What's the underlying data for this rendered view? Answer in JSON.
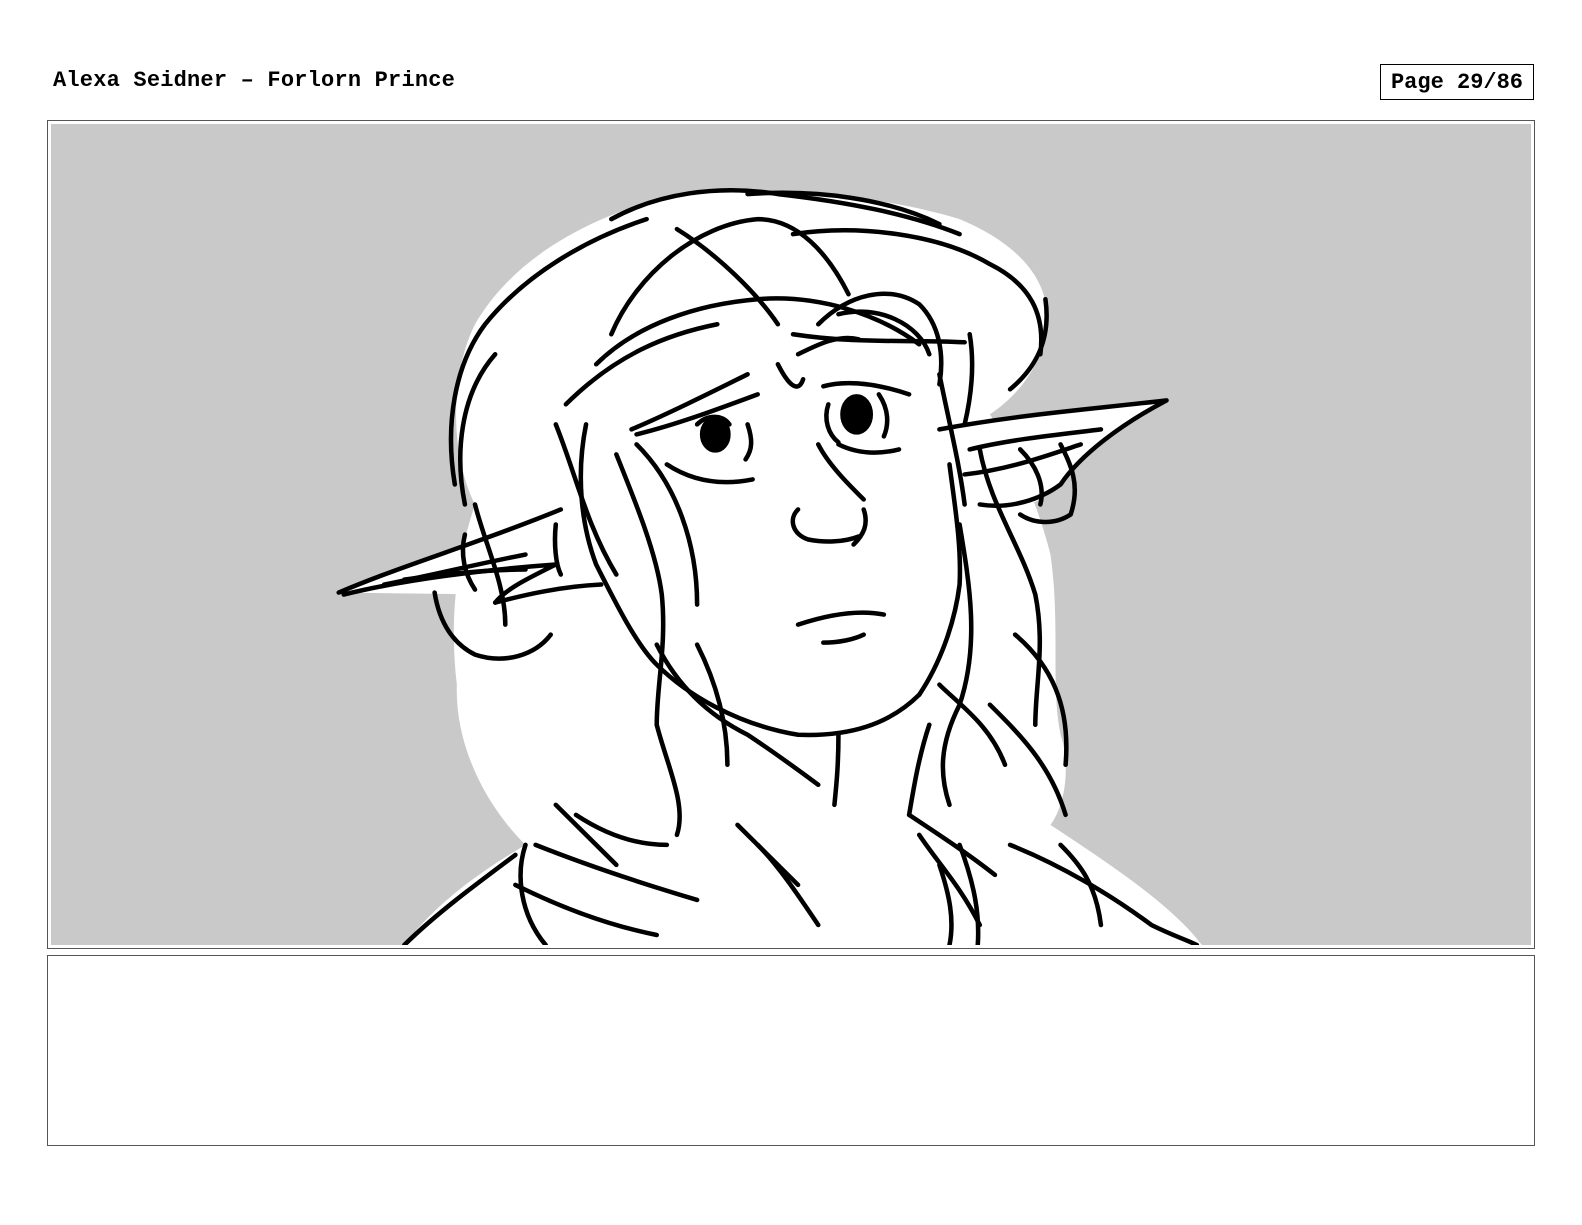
{
  "header": {
    "title": "Alexa Seidner – Forlorn Prince",
    "page_label": "Page 29/86"
  },
  "panel": {
    "background_color": "#c9c9c9",
    "line_color": "#000000"
  },
  "notes": {
    "text": ""
  }
}
